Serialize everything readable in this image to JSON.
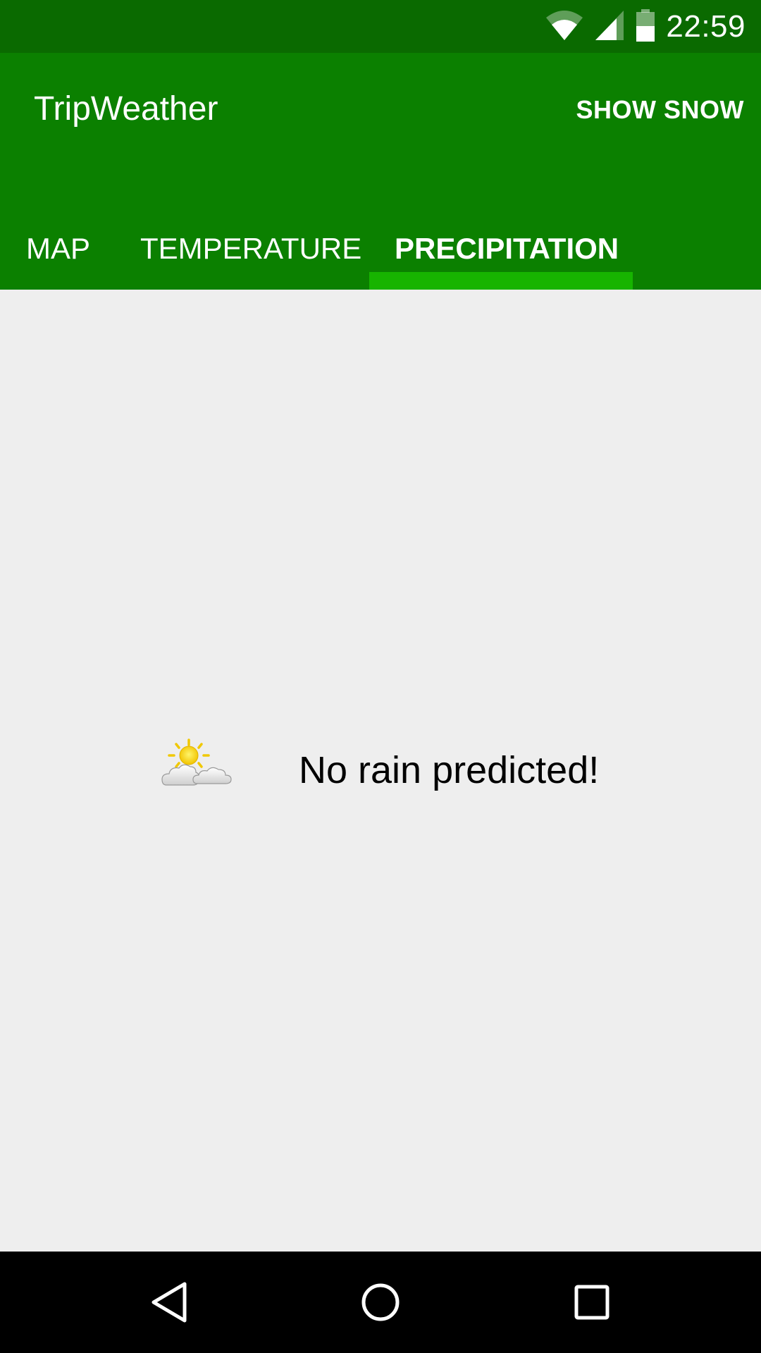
{
  "status_bar": {
    "time": "22:59",
    "icons": [
      "wifi-icon",
      "cellular-signal-icon",
      "battery-icon"
    ]
  },
  "app_bar": {
    "title": "TripWeather",
    "action_label": "SHOW SNOW"
  },
  "tabs": [
    {
      "label": "MAP",
      "active": false
    },
    {
      "label": "TEMPERATURE",
      "active": false
    },
    {
      "label": "PRECIPITATION",
      "active": true
    }
  ],
  "content": {
    "icon": "partly-sunny-icon",
    "message": "No rain predicted!"
  },
  "nav_bar": {
    "buttons": [
      "back-icon",
      "home-icon",
      "recents-icon"
    ]
  },
  "colors": {
    "status_bar": "#0a6a00",
    "primary": "#0b8000",
    "accent": "#17b400",
    "background": "#eeeeee"
  }
}
